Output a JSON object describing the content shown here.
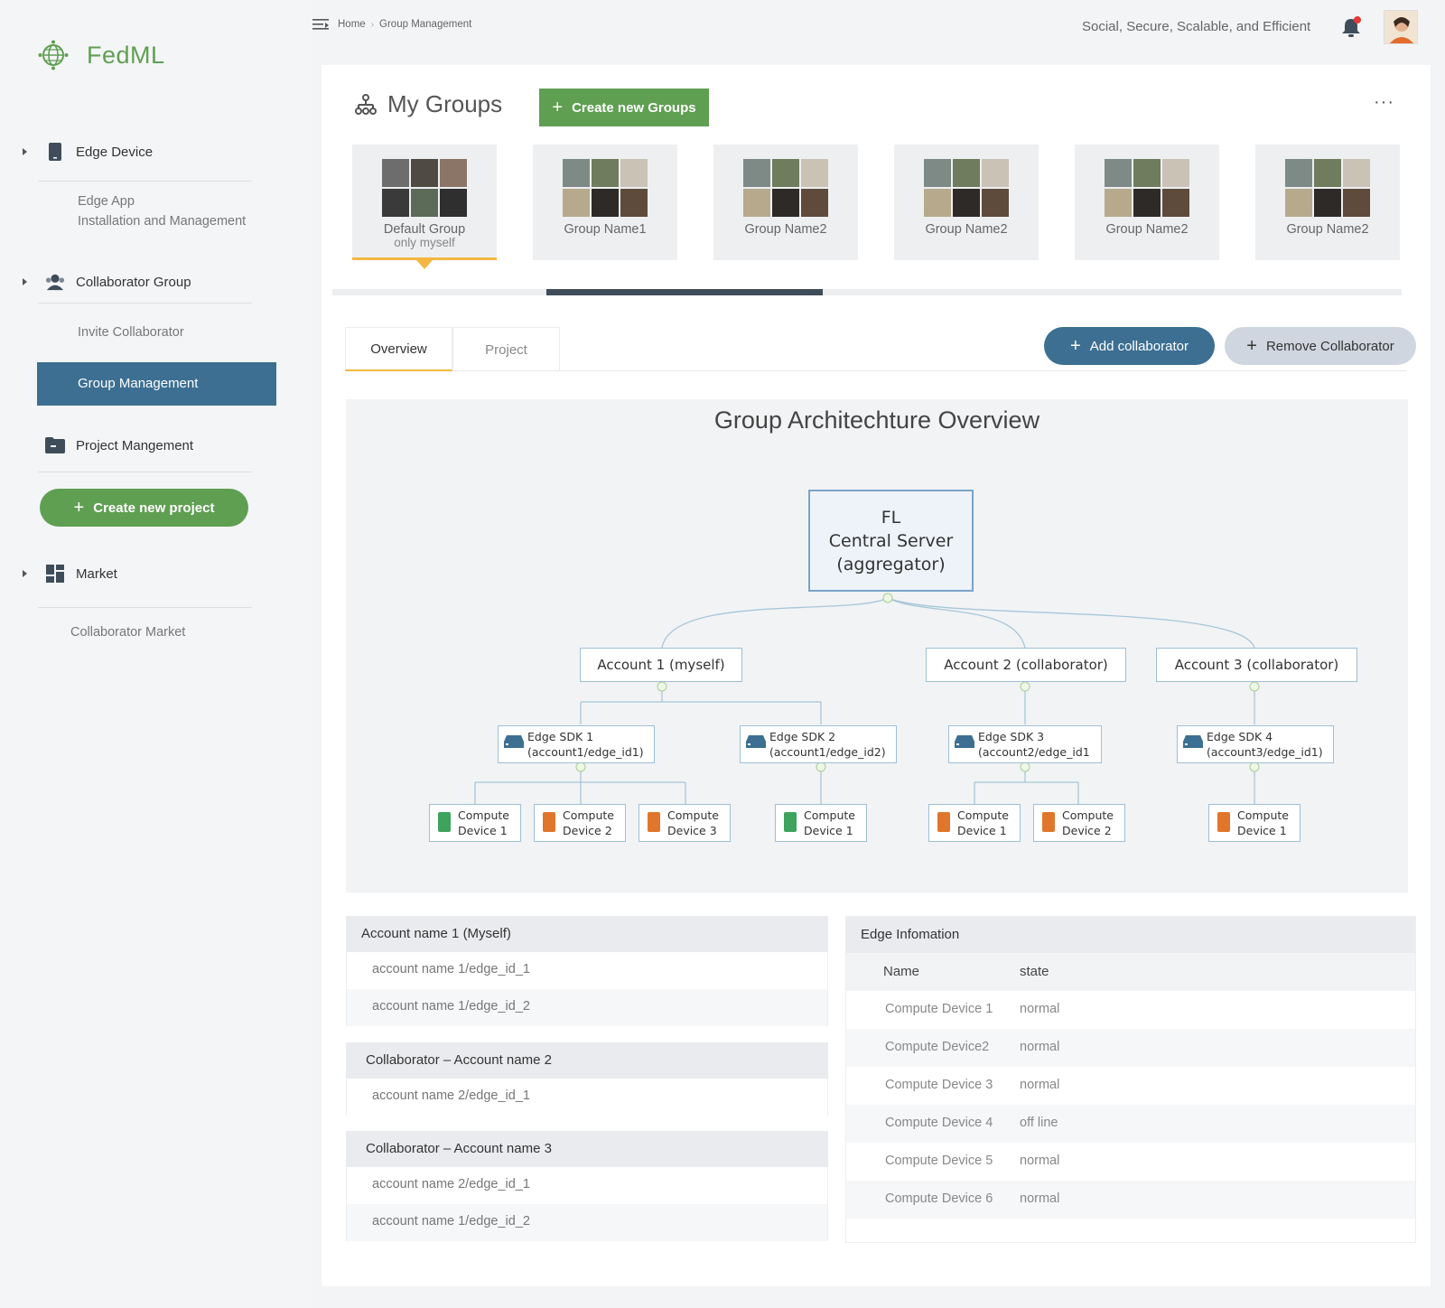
{
  "app": {
    "name": "FedML"
  },
  "header": {
    "breadcrumb": [
      "Home",
      "Group Management"
    ],
    "tagline": "Social, Secure, Scalable, and Efficient"
  },
  "sidebar": {
    "sections": [
      {
        "label": "Edge Device",
        "icon": "phone-icon",
        "items": [
          "Edge App",
          "Installation and Management"
        ]
      },
      {
        "label": "Collaborator Group",
        "icon": "users-icon",
        "items": [
          "Invite Collaborator",
          "Group Management"
        ]
      },
      {
        "label": "Project Mangement",
        "icon": "folder-icon",
        "items": []
      },
      {
        "label": "Market",
        "icon": "grid-icon",
        "items": [
          "Collaborator Market"
        ]
      }
    ],
    "active_item": "Group Management",
    "create_project_label": "Create new project"
  },
  "groups": {
    "title": "My Groups",
    "create_label": "Create new Groups",
    "more_label": "···",
    "cards": [
      {
        "name": "Default Group",
        "sub": "only myself",
        "active": true
      },
      {
        "name": "Group Name1",
        "sub": ""
      },
      {
        "name": "Group Name2",
        "sub": ""
      },
      {
        "name": "Group Name2",
        "sub": ""
      },
      {
        "name": "Group Name2",
        "sub": ""
      },
      {
        "name": "Group Name2",
        "sub": ""
      }
    ]
  },
  "tabs": [
    {
      "label": "Overview",
      "active": true
    },
    {
      "label": "Project",
      "active": false
    }
  ],
  "actions": {
    "add_label": "Add collaborator",
    "remove_label": "Remove Collaborator"
  },
  "architecture": {
    "title": "Group Architechture Overview",
    "server": [
      "FL",
      "Central Server",
      "(aggregator)"
    ],
    "accounts": [
      "Account 1 (myself)",
      "Account 2 (collaborator)",
      "Account 3 (collaborator)"
    ],
    "edges": [
      [
        "Edge SDK 1",
        "(account1/edge_id1)"
      ],
      [
        "Edge SDK 2",
        "(account1/edge_id2)"
      ],
      [
        "Edge SDK 3",
        "(account2/edge_id1"
      ],
      [
        "Edge SDK 4",
        "(account3/edge_id1)"
      ]
    ],
    "devices": [
      [
        "Compute",
        "Device 1"
      ],
      [
        "Compute",
        "Device 2"
      ],
      [
        "Compute",
        "Device 3"
      ],
      [
        "Compute",
        "Device 1"
      ],
      [
        "Compute",
        "Device 1"
      ],
      [
        "Compute",
        "Device 2"
      ],
      [
        "Compute",
        "Device 1"
      ]
    ]
  },
  "accounts_panel": [
    {
      "title": "Account name 1 (Myself)",
      "rows": [
        "account name 1/edge_id_1",
        "account name 1/edge_id_2"
      ]
    },
    {
      "title": "Collaborator – Account name 2",
      "rows": [
        "account name 2/edge_id_1"
      ]
    },
    {
      "title": "Collaborator – Account name 3",
      "rows": [
        "account name 2/edge_id_1",
        "account name 1/edge_id_2"
      ]
    }
  ],
  "edge_info": {
    "title": "Edge Infomation",
    "columns": [
      "Name",
      "state"
    ],
    "rows": [
      [
        "Compute Device 1",
        "normal"
      ],
      [
        "Compute Device2",
        "normal"
      ],
      [
        "Compute Device 3",
        "normal"
      ],
      [
        "Compute Device 4",
        "off line"
      ],
      [
        "Compute Device 5",
        "normal"
      ],
      [
        "Compute Device 6",
        "normal"
      ]
    ]
  },
  "colors": {
    "brand_green": "#5f9f52",
    "primary_blue": "#3c6f92",
    "accent_orange": "#f4b73f",
    "android_green": "#3da35d",
    "ios_orange": "#e0762b"
  }
}
